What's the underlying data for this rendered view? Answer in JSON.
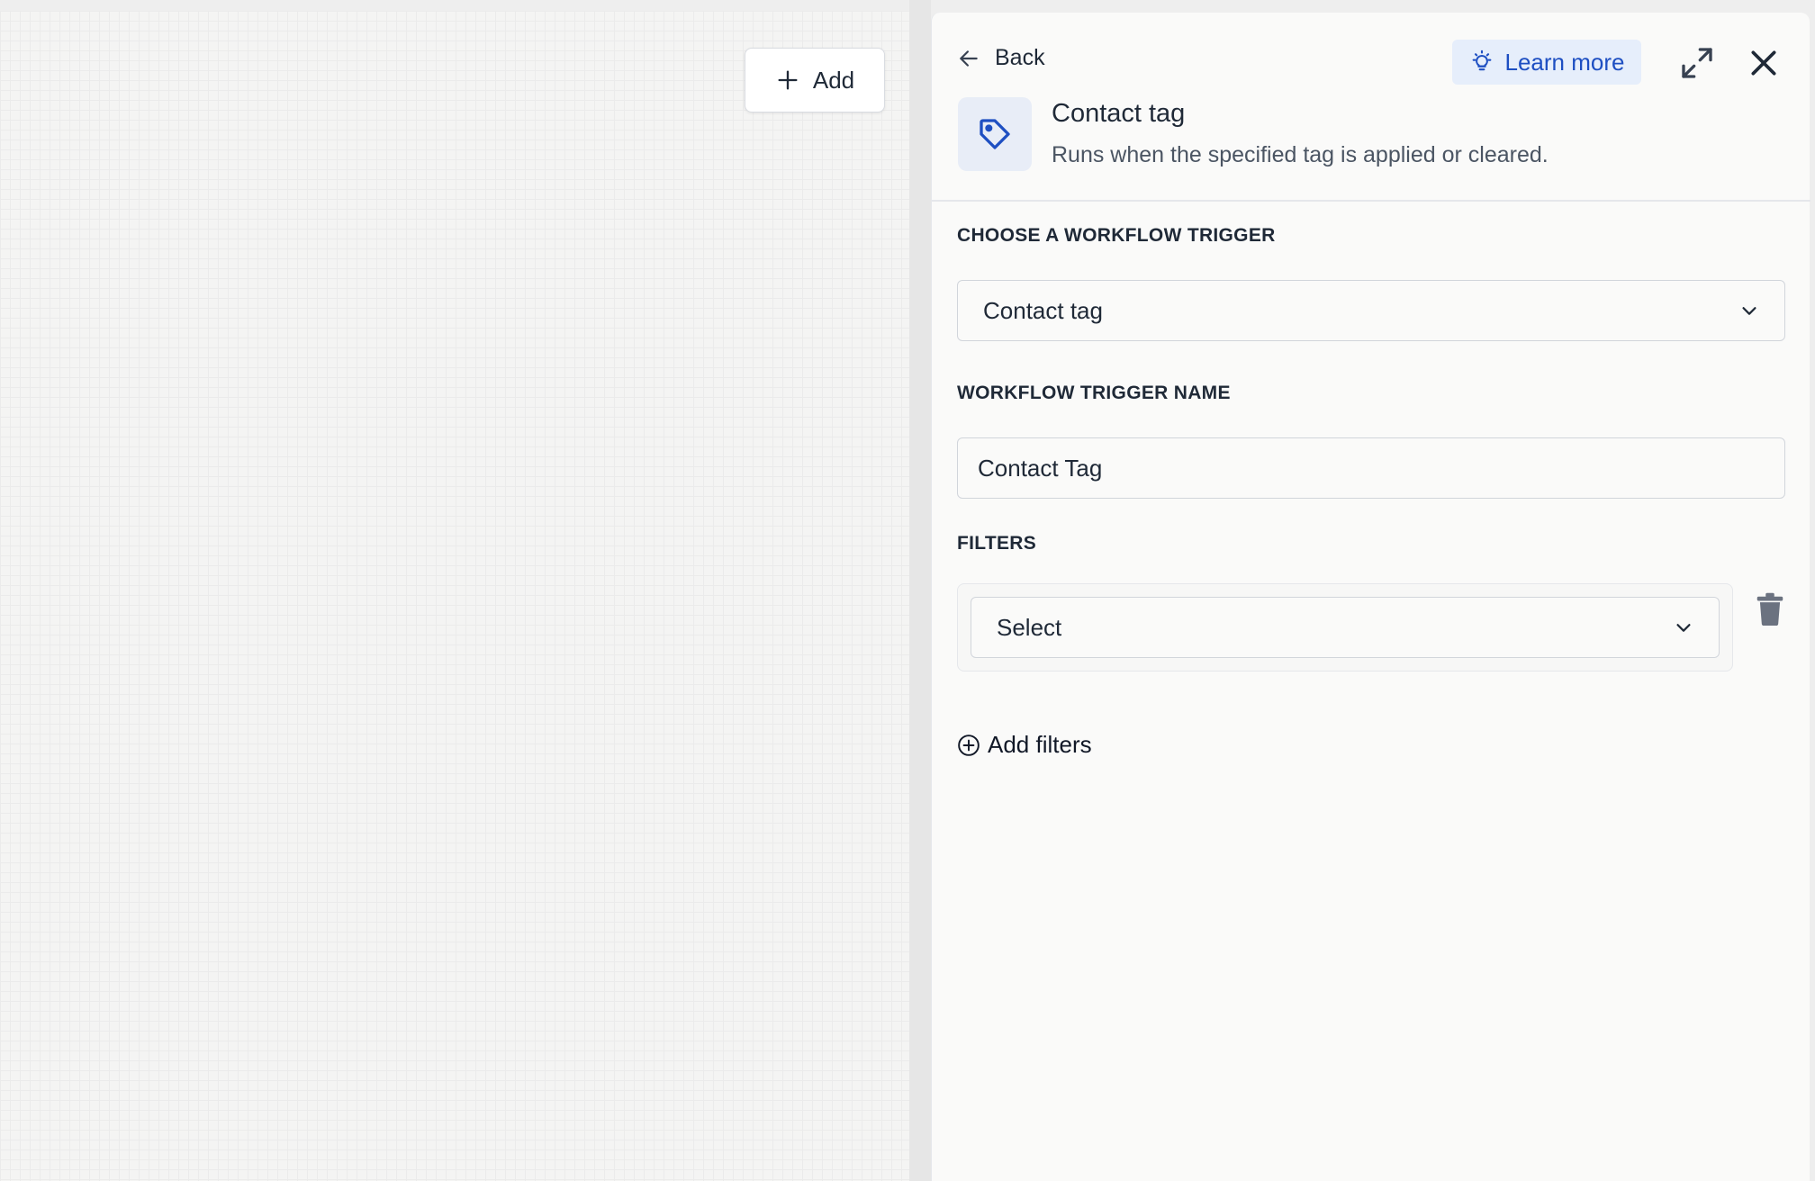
{
  "canvas": {
    "add_button": {
      "label": "Add",
      "icon": "plus-icon"
    }
  },
  "panel": {
    "back_label": "Back",
    "learn_more_label": "Learn more",
    "trigger": {
      "icon": "tag-icon",
      "title": "Contact tag",
      "description": "Runs when the specified tag is applied or cleared."
    },
    "sections": {
      "choose_trigger": {
        "label": "CHOOSE A WORKFLOW TRIGGER",
        "selected_value": "Contact tag"
      },
      "trigger_name": {
        "label": "WORKFLOW TRIGGER NAME",
        "value": "Contact Tag"
      },
      "filters": {
        "label": "FILTERS",
        "select_value": "Select",
        "add_filters_label": "Add filters"
      }
    }
  },
  "colors": {
    "accent": "#1e4fc2",
    "accent_bg": "#e6eefb",
    "text": "#1f2937",
    "muted": "#4b5563"
  }
}
